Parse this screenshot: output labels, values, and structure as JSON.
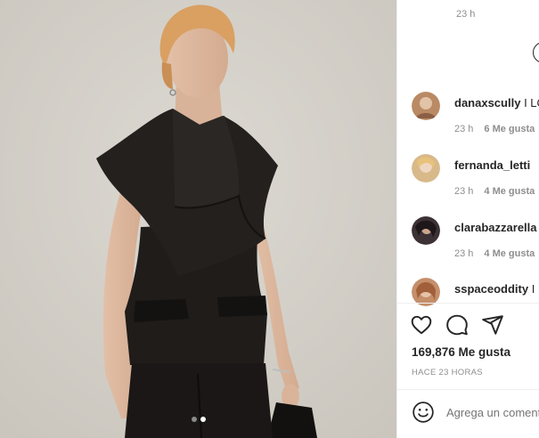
{
  "top_comment_time": "23 h",
  "comments": [
    {
      "username": "danaxscully",
      "text": "I LO",
      "time": "23 h",
      "likes": "6 Me gusta",
      "avatar_color": "#b98a64"
    },
    {
      "username": "fernanda_letti",
      "text": "",
      "time": "23 h",
      "likes": "4 Me gusta",
      "avatar_color": "#d8b98a"
    },
    {
      "username": "clarabazzarella",
      "text": "",
      "time": "23 h",
      "likes": "4 Me gusta",
      "avatar_color": "#3c3236"
    },
    {
      "username": "sspaceoddity",
      "text": "I",
      "time": "",
      "likes": "",
      "avatar_color": "#c48f6a"
    }
  ],
  "actions": {
    "like_icon": "heart-icon",
    "comment_icon": "comment-icon",
    "share_icon": "share-icon"
  },
  "likes_count": "169,876 Me gusta",
  "post_time": "HACE 23 HORAS",
  "add_comment_placeholder": "Agrega un comentario...",
  "carousel": {
    "total": 2,
    "active": 2
  },
  "colors": {
    "photo_bg": "#d4d0c8",
    "garment": "#1d1a18",
    "text": "#262626",
    "muted": "#8e8e8e"
  }
}
